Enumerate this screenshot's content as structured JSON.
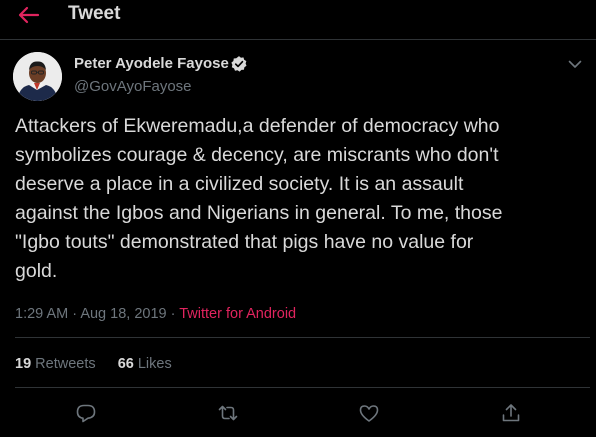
{
  "header": {
    "title": "Tweet",
    "back_icon": "arrow-left-icon",
    "accent_color": "#e0245e"
  },
  "tweet": {
    "author": {
      "name": "Peter Ayodele Fayose",
      "handle": "@GovAyoFayose",
      "verified_icon": "verified-badge-icon"
    },
    "text": "Attackers of Ekweremadu,a defender of democracy who\nsymbolizes courage & decency, are miscrants who don't\ndeserve a place in a civilized society. It is an assault\nagainst the Igbos and Nigerians in general. To me, those\n\"Igbo touts\" demonstrated that pigs have no value for\ngold.",
    "time": "1:29 AM",
    "date": "Aug 18, 2019",
    "separator": "·",
    "source": "Twitter for Android",
    "stats": {
      "retweets_count": "19",
      "retweets_label": "Retweets",
      "likes_count": "66",
      "likes_label": "Likes"
    }
  },
  "actions": [
    {
      "icon": "reply-icon"
    },
    {
      "icon": "retweet-icon"
    },
    {
      "icon": "like-icon"
    },
    {
      "icon": "share-icon"
    }
  ],
  "colors": {
    "background": "#000000",
    "text": "#d9d9d9",
    "secondary_text": "#6e767d",
    "divider": "#2f3336",
    "link": "#e0245e"
  }
}
